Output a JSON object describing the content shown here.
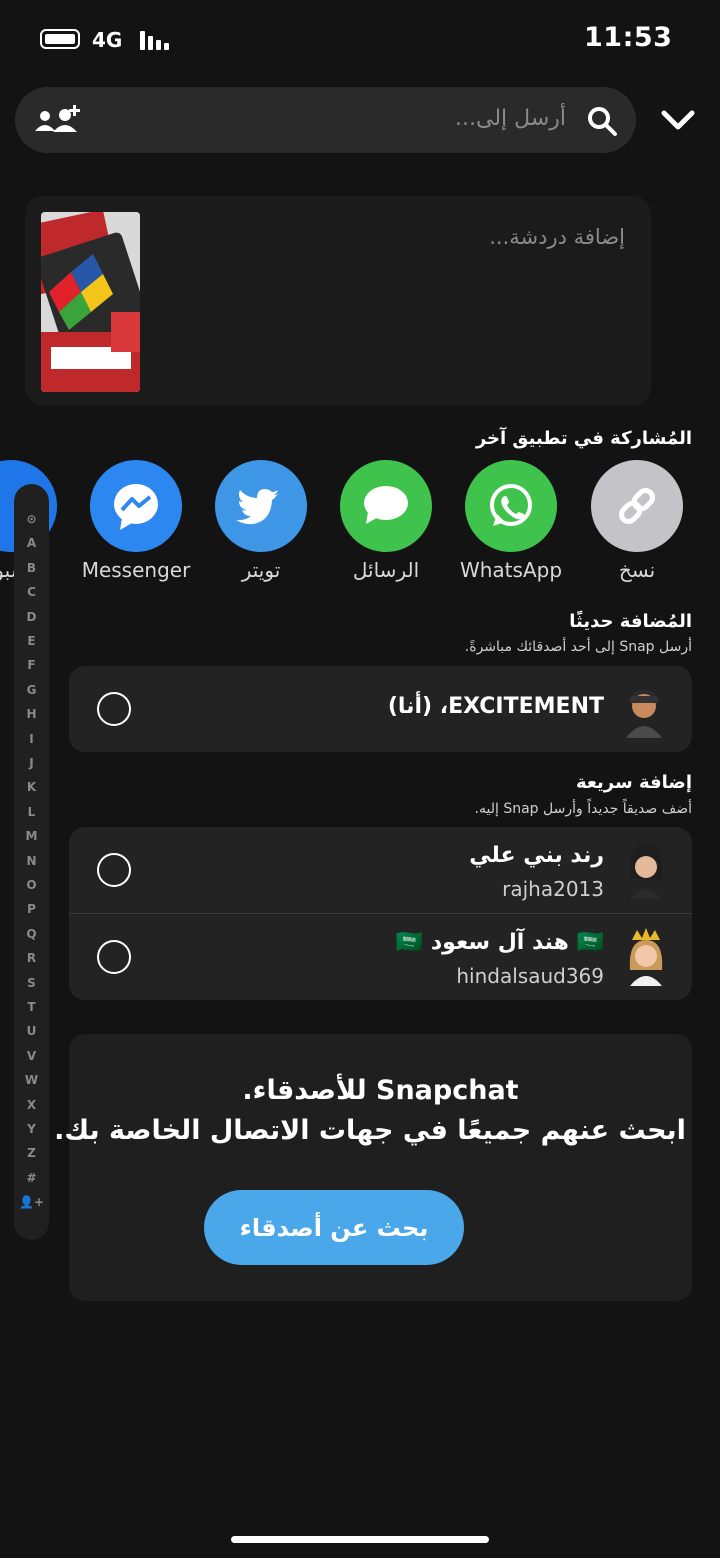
{
  "status_bar": {
    "time": "11:53",
    "network": "4G"
  },
  "search": {
    "placeholder": "أرسل إلى..."
  },
  "chat": {
    "placeholder": "إضافة دردشة..."
  },
  "share": {
    "title": "المُشاركة في تطبيق آخر",
    "items": [
      {
        "label": "نسخ",
        "icon": "link-icon",
        "color": "#c4c4c8"
      },
      {
        "label": "WhatsApp",
        "icon": "whatsapp-icon",
        "color": "#3fc34d"
      },
      {
        "label": "الرسائل",
        "icon": "messages-icon",
        "color": "#3fc34d"
      },
      {
        "label": "تويتر",
        "icon": "twitter-icon",
        "color": "#3d97e6"
      },
      {
        "label": "Messenger",
        "icon": "messenger-icon",
        "color": "#2d87f0"
      },
      {
        "label": "فيسبوك",
        "icon": "facebook-icon",
        "color": "#1f76e9"
      }
    ]
  },
  "recently_added": {
    "title": "المُضافة حديثًا",
    "subtitle": "أرسل Snap إلى أحد أصدقائك مباشرةً.",
    "items": [
      {
        "name": "EXCITEMENT، (أنا)"
      }
    ]
  },
  "quick_add": {
    "title": "إضافة سريعة",
    "subtitle": "أضف صديقاً جديداً وأرسل Snap إليه.",
    "items": [
      {
        "name": "رند بني علي",
        "username": "rajha2013"
      },
      {
        "name": "🇸🇦 هند آل سعود 🇸🇦",
        "username": "hindalsaud369"
      }
    ]
  },
  "alphabet": [
    "⊙",
    "A",
    "B",
    "C",
    "D",
    "E",
    "F",
    "G",
    "H",
    "I",
    "J",
    "K",
    "L",
    "M",
    "N",
    "O",
    "P",
    "Q",
    "R",
    "S",
    "T",
    "U",
    "V",
    "W",
    "X",
    "Y",
    "Z",
    "#",
    "👤+"
  ],
  "contacts": {
    "line1": "Snapchat للأصدقاء.",
    "line2": "ابحث عنهم جميعًا في جهات الاتصال الخاصة بك.",
    "button": "بحث عن أصدقاء"
  },
  "colors": {
    "background": "#131313",
    "accent": "#4aa8ea"
  }
}
